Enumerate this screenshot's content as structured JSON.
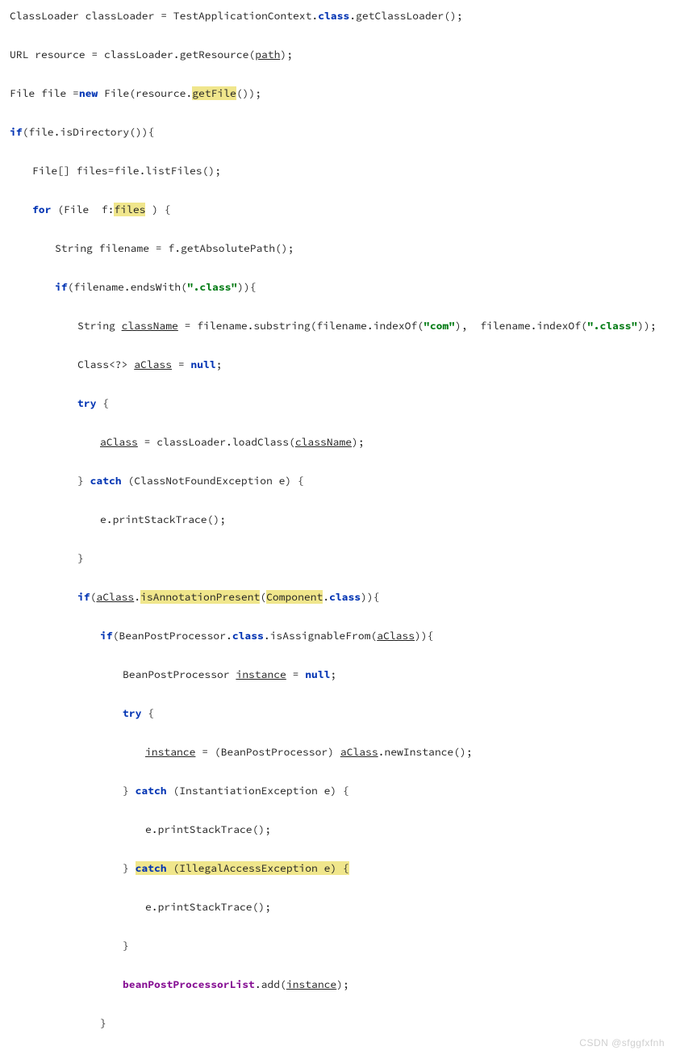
{
  "code": {
    "l1a": "ClassLoader classLoader = TestApplicationContext.",
    "l1b": "class",
    "l1c": ".getClassLoader();",
    "l2a": "URL resource = classLoader.getResource(",
    "l2b": "path",
    "l2c": ");",
    "l3a": "File file =",
    "l3b": "new",
    "l3c": " File(resource.",
    "l3d": "getFile",
    "l3e": "());",
    "l4a": "if",
    "l4b": "(file.isDirectory()){",
    "l5": "File[] files=file.listFiles();",
    "l6a": "for",
    "l6b": " (File  f:",
    "l6c": "files",
    "l6d": " ) {",
    "l7": "String filename = f.getAbsolutePath();",
    "l8a": "if",
    "l8b": "(filename.endsWith(",
    "l8c": "\".class\"",
    "l8d": ")){",
    "l9a": "String ",
    "l9b": "className",
    "l9c": " = filename.substring(filename.indexOf(",
    "l9d": "\"com\"",
    "l9e": "),  filename.indexOf(",
    "l9f": "\".class\"",
    "l9g": "));",
    "l10a": "Class<?> ",
    "l10b": "aClass",
    "l10c": " = ",
    "l10d": "null",
    "l10e": ";",
    "l11a": "try",
    "l11b": " {",
    "l12a": "aClass",
    "l12b": " = classLoader.loadClass(",
    "l12c": "className",
    "l12d": ");",
    "l13a": "} ",
    "l13b": "catch",
    "l13c": " (ClassNotFoundException e) {",
    "l14": "e.printStackTrace();",
    "l15": "}",
    "l16a": "if",
    "l16b": "(",
    "l16c": "aClass",
    "l16d": ".",
    "l16e": "isAnnotationPresent",
    "l16f": "(",
    "l16g": "Component",
    "l16h": ".",
    "l16i": "class",
    "l16j": ")){",
    "l17a": "if",
    "l17b": "(BeanPostProcessor.",
    "l17c": "class",
    "l17d": ".isAssignableFrom(",
    "l17e": "aClass",
    "l17f": ")){",
    "l18a": "BeanPostProcessor ",
    "l18b": "instance",
    "l18c": " = ",
    "l18d": "null",
    "l18e": ";",
    "l19a": "try",
    "l19b": " {",
    "l20a": "instance",
    "l20b": " = (BeanPostProcessor) ",
    "l20c": "aClass",
    "l20d": ".newInstance();",
    "l21a": "} ",
    "l21b": "catch",
    "l21c": " (InstantiationException e) {",
    "l22": "e.printStackTrace();",
    "l23a": "} ",
    "l23b": "catch",
    "l23c": " (",
    "l23d": "IllegalAccessException e",
    "l23e": ") {",
    "l24": "e.printStackTrace();",
    "l25": "}",
    "l26a": "beanPostProcessorList",
    "l26b": ".add(",
    "l26c": "instance",
    "l26d": ");",
    "l27": "}"
  },
  "watermark": "CSDN @sfggfxfnh"
}
